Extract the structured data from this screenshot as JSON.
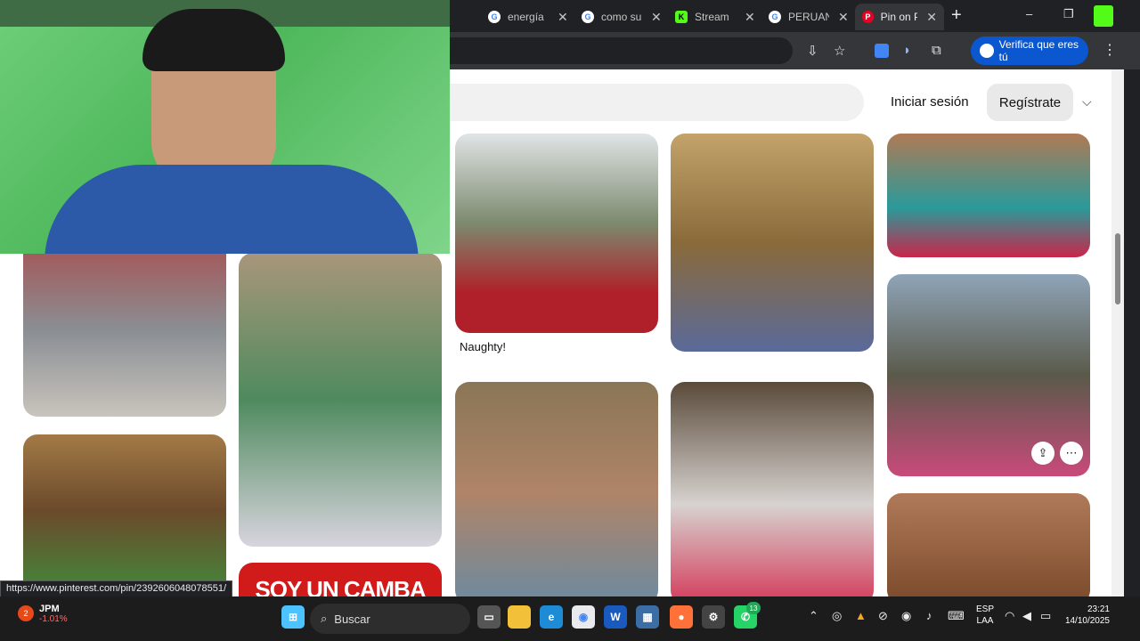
{
  "browser": {
    "tabs": [
      {
        "title": "energía",
        "favicon": "G",
        "favicon_color": "#4285f4"
      },
      {
        "title": "como su",
        "favicon": "G",
        "favicon_color": "#4285f4"
      },
      {
        "title": "Stream",
        "favicon": "K",
        "favicon_color": "#53fc18"
      },
      {
        "title": "PERUAN",
        "favicon": "G",
        "favicon_color": "#4285f4"
      },
      {
        "title": "Pin on P",
        "favicon": "P",
        "favicon_color": "#e60023",
        "active": true
      }
    ],
    "new_tab_symbol": "+",
    "window_controls": [
      "–",
      "❐",
      "✕"
    ],
    "verify_label": "Verifica que eres tú",
    "status_url": "https://www.pinterest.com/pin/2392606048078551/"
  },
  "header": {
    "login_label": "Iniciar sesión",
    "signup_label": "Regístrate"
  },
  "pins": {
    "caption_naughty": "Naughty!",
    "banner_text": "SOY UN CAMBA"
  },
  "taskbar": {
    "stock": {
      "ticker": "JPM",
      "change": "-1.01%",
      "badge": "2"
    },
    "search_placeholder": "Buscar",
    "whatsapp_badge": "13",
    "language": {
      "line1": "ESP",
      "line2": "LAA"
    },
    "clock": {
      "time": "23:21",
      "date": "14/10/2025"
    }
  },
  "colors": {
    "pinterest_red": "#e60023",
    "chrome_blue": "#0b57d0",
    "webcam_green": "#5cc268"
  }
}
